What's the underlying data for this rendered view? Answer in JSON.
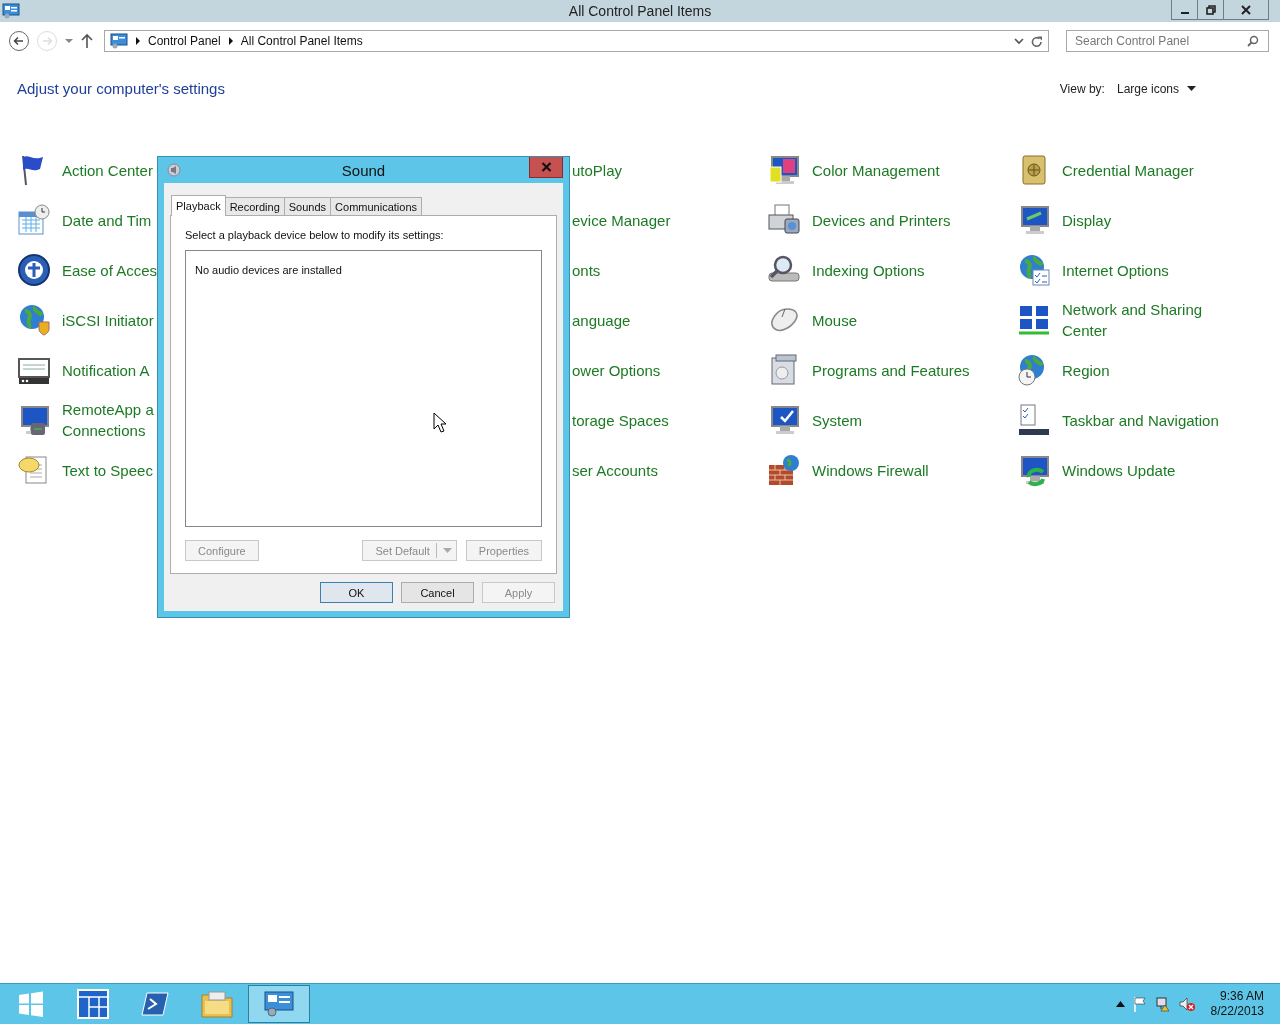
{
  "window": {
    "title": "All Control Panel Items"
  },
  "address_bar": {
    "breadcrumbs": [
      "Control Panel",
      "All Control Panel Items"
    ]
  },
  "search": {
    "placeholder": "Search Control Panel"
  },
  "heading": "Adjust your computer's settings",
  "view_by": {
    "label": "View by:",
    "value": "Large icons"
  },
  "columns": [
    {
      "items": [
        {
          "kind": "flag",
          "lines": [
            "Action Center"
          ]
        },
        {
          "kind": "calendar",
          "lines": [
            "Date and Tim"
          ]
        },
        {
          "kind": "ease",
          "lines": [
            "Ease of Acces"
          ]
        },
        {
          "kind": "globe-shield",
          "lines": [
            "iSCSI Initiator"
          ]
        },
        {
          "kind": "notification",
          "lines": [
            "Notification A"
          ]
        },
        {
          "kind": "remote",
          "lines": [
            "RemoteApp a",
            "Connections"
          ]
        },
        {
          "kind": "speech",
          "lines": [
            "Text to Speec"
          ]
        }
      ]
    },
    {
      "items": [
        {
          "kind": "hidden",
          "lines": [
            "utoPlay"
          ]
        },
        {
          "kind": "hidden",
          "lines": [
            "evice Manager"
          ]
        },
        {
          "kind": "hidden",
          "lines": [
            "onts"
          ]
        },
        {
          "kind": "hidden",
          "lines": [
            "anguage"
          ]
        },
        {
          "kind": "hidden",
          "lines": [
            "ower Options"
          ]
        },
        {
          "kind": "hidden",
          "lines": [
            "torage Spaces"
          ]
        },
        {
          "kind": "hidden",
          "lines": [
            "ser Accounts"
          ]
        }
      ]
    },
    {
      "items": [
        {
          "kind": "color",
          "lines": [
            "Color Management"
          ]
        },
        {
          "kind": "printer",
          "lines": [
            "Devices and Printers"
          ]
        },
        {
          "kind": "magnifier",
          "lines": [
            "Indexing Options"
          ]
        },
        {
          "kind": "mouse",
          "lines": [
            "Mouse"
          ]
        },
        {
          "kind": "programs",
          "lines": [
            "Programs and Features"
          ]
        },
        {
          "kind": "system",
          "lines": [
            "System"
          ]
        },
        {
          "kind": "firewall",
          "lines": [
            "Windows Firewall"
          ]
        }
      ]
    },
    {
      "items": [
        {
          "kind": "vault",
          "lines": [
            "Credential Manager"
          ]
        },
        {
          "kind": "display",
          "lines": [
            "Display"
          ]
        },
        {
          "kind": "globe-list",
          "lines": [
            "Internet Options"
          ]
        },
        {
          "kind": "network",
          "lines": [
            "Network and Sharing",
            "Center"
          ]
        },
        {
          "kind": "globe-clock",
          "lines": [
            "Region"
          ]
        },
        {
          "kind": "checklist",
          "lines": [
            "Taskbar and Navigation"
          ]
        },
        {
          "kind": "update",
          "lines": [
            "Windows Update"
          ]
        }
      ]
    }
  ],
  "dialog": {
    "title": "Sound",
    "tabs": [
      {
        "label": "Playback",
        "selected": true
      },
      {
        "label": "Recording",
        "selected": false
      },
      {
        "label": "Sounds",
        "selected": false
      },
      {
        "label": "Communications",
        "selected": false
      }
    ],
    "instruction": "Select a playback device below to modify its settings:",
    "list_message": "No audio devices are installed",
    "buttons": [
      {
        "label": "Configure",
        "disabled": true,
        "kind": "plain"
      },
      {
        "label": "Set Default",
        "disabled": true,
        "kind": "split"
      },
      {
        "label": "Properties",
        "disabled": true,
        "kind": "plain"
      }
    ],
    "footer_buttons": [
      {
        "label": "OK",
        "disabled": false,
        "default": true
      },
      {
        "label": "Cancel",
        "disabled": false,
        "default": false
      },
      {
        "label": "Apply",
        "disabled": true,
        "default": false
      }
    ]
  },
  "taskbar": {
    "apps": [
      {
        "kind": "start",
        "selected": false
      },
      {
        "kind": "tiles",
        "selected": false
      },
      {
        "kind": "shell",
        "selected": false
      },
      {
        "kind": "folder",
        "selected": false
      },
      {
        "kind": "control-panel",
        "selected": true
      }
    ],
    "clock": {
      "time": "9:36 AM",
      "date": "8/22/2013"
    }
  }
}
